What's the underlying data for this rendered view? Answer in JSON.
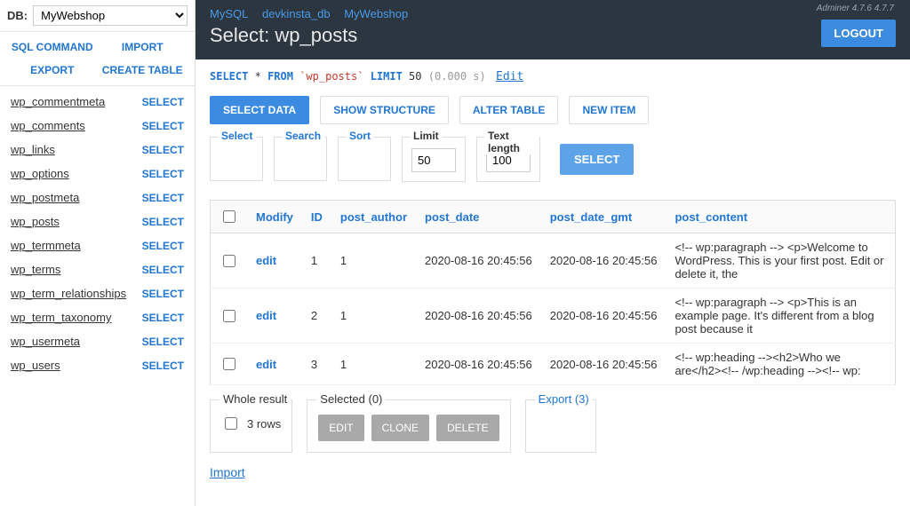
{
  "sidebar": {
    "db_label": "DB:",
    "db_selected": "MyWebshop",
    "actions": {
      "sql_command": "SQL COMMAND",
      "import": "IMPORT",
      "export": "EXPORT",
      "create_table": "CREATE TABLE"
    },
    "select_label": "SELECT",
    "tables": [
      "wp_commentmeta",
      "wp_comments",
      "wp_links",
      "wp_options",
      "wp_postmeta",
      "wp_posts",
      "wp_termmeta",
      "wp_terms",
      "wp_term_relationships",
      "wp_term_taxonomy",
      "wp_usermeta",
      "wp_users"
    ]
  },
  "header": {
    "breadcrumbs": [
      "MySQL",
      "devkinsta_db",
      "MyWebshop"
    ],
    "title": "Select: wp_posts",
    "logout": "LOGOUT",
    "version": "Adminer 4.7.6 4.7.7"
  },
  "sql": {
    "select": "SELECT",
    "star": "*",
    "from": "FROM",
    "table": "`wp_posts`",
    "limit_kw": "LIMIT",
    "limit_val": "50",
    "time": "(0.000 s)",
    "edit": "Edit"
  },
  "tabs": {
    "select_data": "SELECT DATA",
    "show_structure": "SHOW STRUCTURE",
    "alter_table": "ALTER TABLE",
    "new_item": "NEW ITEM"
  },
  "filters": {
    "select": "Select",
    "search": "Search",
    "sort": "Sort",
    "limit_label": "Limit",
    "limit_value": "50",
    "textlen_label": "Text length",
    "textlen_value": "100",
    "button": "SELECT"
  },
  "table": {
    "headers": {
      "modify": "Modify",
      "id": "ID",
      "post_author": "post_author",
      "post_date": "post_date",
      "post_date_gmt": "post_date_gmt",
      "post_content": "post_content"
    },
    "edit_label": "edit",
    "rows": [
      {
        "id": "1",
        "author": "1",
        "date": "2020-08-16 20:45:56",
        "gmt": "2020-08-16 20:45:56",
        "content": "<!-- wp:paragraph -->\n<p>Welcome to WordPress. This is your first post. Edit or delete it, the"
      },
      {
        "id": "2",
        "author": "1",
        "date": "2020-08-16 20:45:56",
        "gmt": "2020-08-16 20:45:56",
        "content": "<!-- wp:paragraph -->\n<p>This is an example page. It's different from a blog post because it"
      },
      {
        "id": "3",
        "author": "1",
        "date": "2020-08-16 20:45:56",
        "gmt": "2020-08-16 20:45:56",
        "content": "<!-- wp:heading --><h2>Who we are</h2><!-- /wp:heading --><!-- wp:"
      }
    ]
  },
  "footer": {
    "whole_result": "Whole result",
    "rows_text": "3 rows",
    "selected": "Selected (0)",
    "edit": "EDIT",
    "clone": "CLONE",
    "delete": "DELETE",
    "export": "Export (3)",
    "import": "Import"
  }
}
